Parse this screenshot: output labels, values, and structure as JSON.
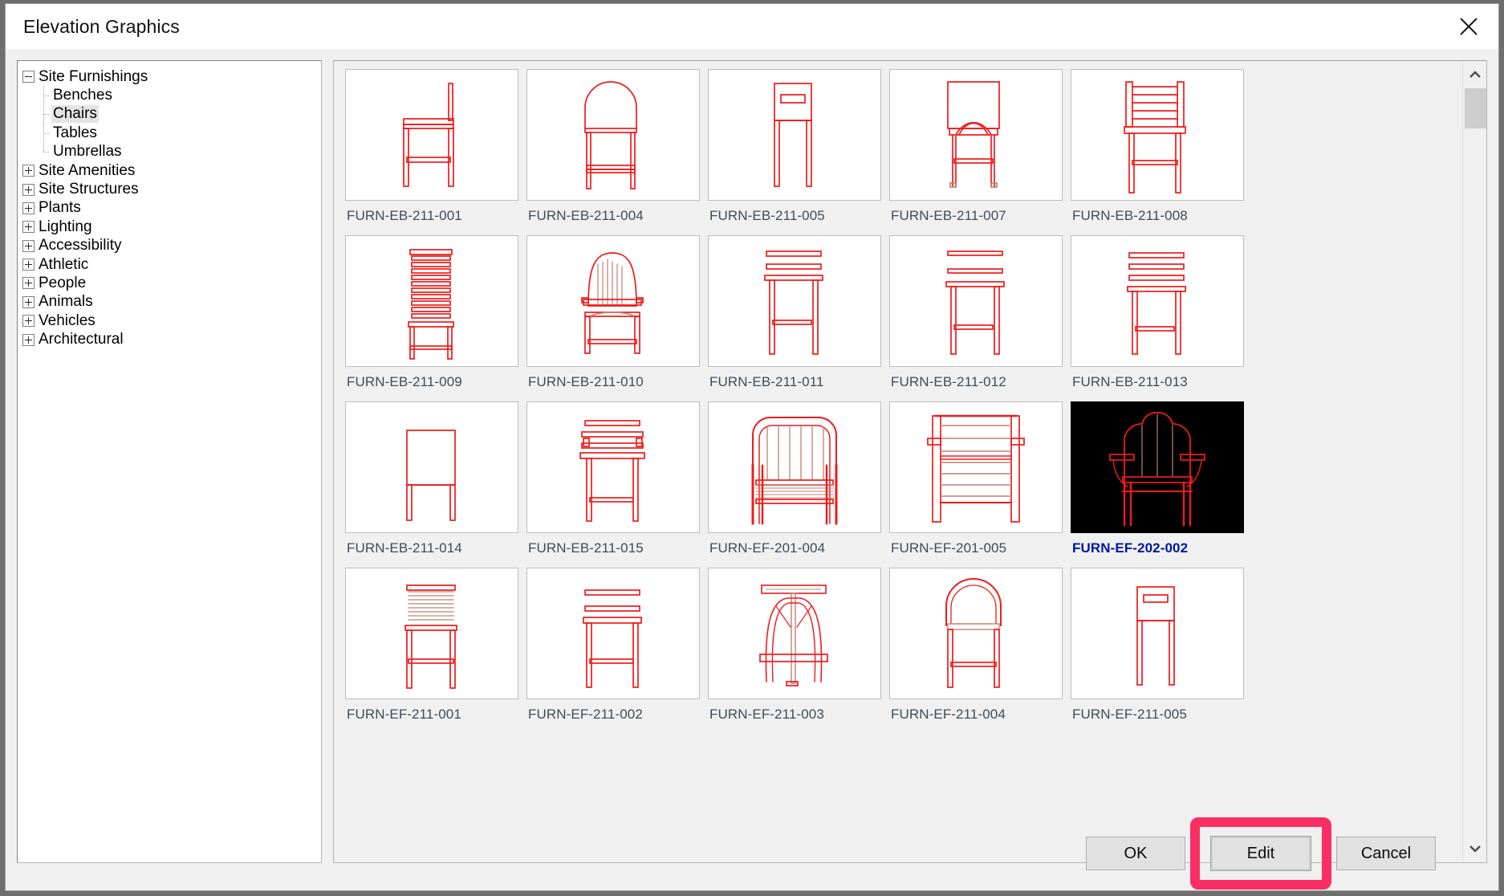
{
  "window": {
    "title": "Elevation Graphics",
    "close_icon": "close-icon"
  },
  "tree": {
    "nodes": [
      {
        "label": "Site Furnishings",
        "state": "expanded",
        "level": 0,
        "selected": false
      },
      {
        "label": "Benches",
        "state": "leaf",
        "level": 1,
        "selected": false,
        "last": false
      },
      {
        "label": "Chairs",
        "state": "leaf",
        "level": 1,
        "selected": true,
        "last": false
      },
      {
        "label": "Tables",
        "state": "leaf",
        "level": 1,
        "selected": false,
        "last": false
      },
      {
        "label": "Umbrellas",
        "state": "leaf",
        "level": 1,
        "selected": false,
        "last": true
      },
      {
        "label": "Site Amenities",
        "state": "collapsed",
        "level": 0,
        "selected": false
      },
      {
        "label": "Site Structures",
        "state": "collapsed",
        "level": 0,
        "selected": false
      },
      {
        "label": "Plants",
        "state": "collapsed",
        "level": 0,
        "selected": false
      },
      {
        "label": "Lighting",
        "state": "collapsed",
        "level": 0,
        "selected": false
      },
      {
        "label": "Accessibility",
        "state": "collapsed",
        "level": 0,
        "selected": false
      },
      {
        "label": "Athletic",
        "state": "collapsed",
        "level": 0,
        "selected": false
      },
      {
        "label": "People",
        "state": "collapsed",
        "level": 0,
        "selected": false
      },
      {
        "label": "Animals",
        "state": "collapsed",
        "level": 0,
        "selected": false
      },
      {
        "label": "Vehicles",
        "state": "collapsed",
        "level": 0,
        "selected": false
      },
      {
        "label": "Architectural",
        "state": "collapsed",
        "level": 0,
        "selected": false
      }
    ]
  },
  "gallery": {
    "line_color": "#ef1b1b",
    "line_color_light": "#c08070",
    "selected_background": "#000000",
    "selected_label_color": "#00189c",
    "items": [
      {
        "label": "FURN-EB-211-001",
        "icon": "barstool-side-elevation",
        "selected": false
      },
      {
        "label": "FURN-EB-211-004",
        "icon": "arched-back-barstool",
        "selected": false
      },
      {
        "label": "FURN-EB-211-005",
        "icon": "slot-back-barstool",
        "selected": false
      },
      {
        "label": "FURN-EB-211-007",
        "icon": "square-back-arched-leg-stool",
        "selected": false
      },
      {
        "label": "FURN-EB-211-008",
        "icon": "slatted-back-barstool",
        "selected": false
      },
      {
        "label": "FURN-EB-211-009",
        "icon": "louvered-back-barstool",
        "selected": false
      },
      {
        "label": "FURN-EB-211-010",
        "icon": "fanback-adirondack-barstool",
        "selected": false
      },
      {
        "label": "FURN-EB-211-011",
        "icon": "two-rail-back-barstool",
        "selected": false
      },
      {
        "label": "FURN-EB-211-012",
        "icon": "open-frame-barstool",
        "selected": false
      },
      {
        "label": "FURN-EB-211-013",
        "icon": "three-slat-back-barstool",
        "selected": false
      },
      {
        "label": "FURN-EB-211-014",
        "icon": "plain-back-stool",
        "selected": false
      },
      {
        "label": "FURN-EB-211-015",
        "icon": "slatted-arm-barstool",
        "selected": false
      },
      {
        "label": "FURN-EF-201-004",
        "icon": "spindle-back-armchair",
        "selected": false
      },
      {
        "label": "FURN-EF-201-005",
        "icon": "horizontal-slat-armchair",
        "selected": false
      },
      {
        "label": "FURN-EF-202-002",
        "icon": "adirondack-armchair",
        "selected": true
      },
      {
        "label": "FURN-EF-211-001",
        "icon": "louvered-back-chair",
        "selected": false
      },
      {
        "label": "FURN-EF-211-002",
        "icon": "flat-top-chair",
        "selected": false
      },
      {
        "label": "FURN-EF-211-003",
        "icon": "pedestal-back-chair",
        "selected": false
      },
      {
        "label": "FURN-EF-211-004",
        "icon": "arched-back-chair",
        "selected": false
      },
      {
        "label": "FURN-EF-211-005",
        "icon": "slot-back-chair",
        "selected": false
      }
    ]
  },
  "scrollbar": {
    "up_icon": "chevron-up-icon",
    "down_icon": "chevron-down-icon",
    "thumb_position_percent": 4
  },
  "footer": {
    "ok_label": "OK",
    "edit_label": "Edit",
    "cancel_label": "Cancel",
    "highlight_color": "#f92e63"
  }
}
